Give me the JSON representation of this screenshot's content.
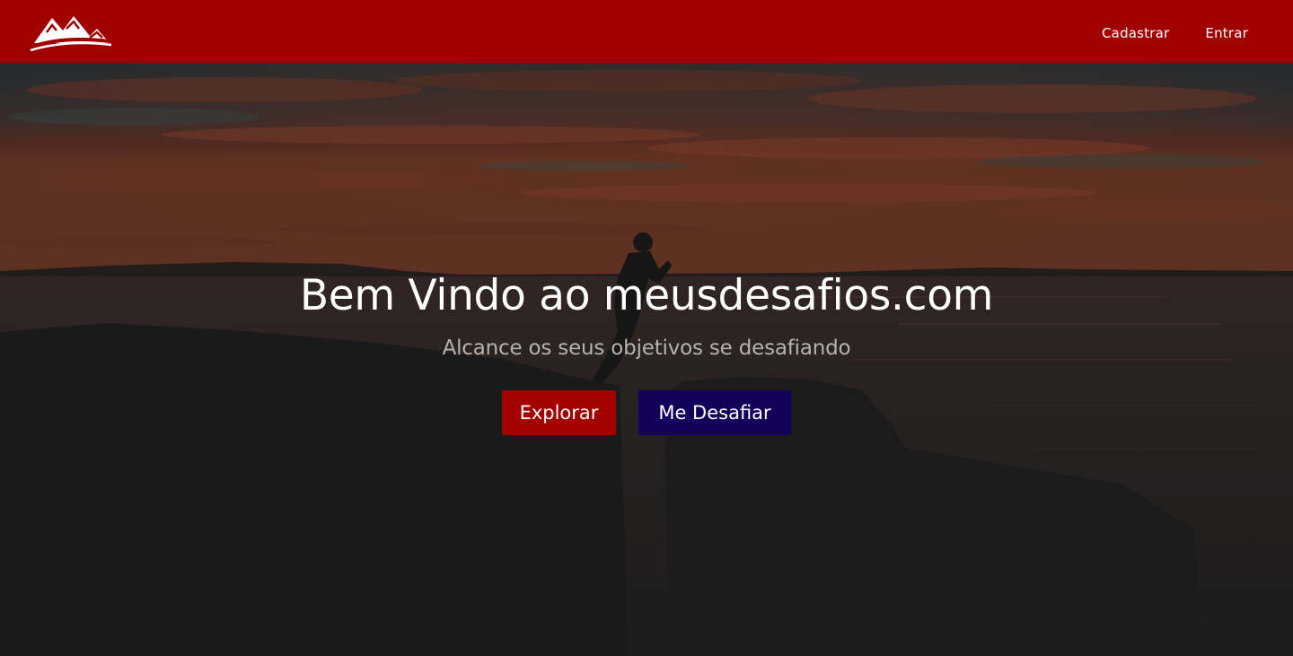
{
  "brand": {
    "logo_icon": "mountains-logo-icon",
    "color": "#a10000"
  },
  "nav": {
    "items": [
      {
        "label": "Cadastrar"
      },
      {
        "label": "Entrar"
      }
    ]
  },
  "hero": {
    "title": "Bem Vindo ao meusdesafios.com",
    "subtitle": "Alcance os seus objetivos se desafiando",
    "buttons": [
      {
        "label": "Explorar",
        "color": "#a30000"
      },
      {
        "label": "Me Desafiar",
        "color": "#130058"
      }
    ],
    "background": "sunset-sea-silhouette-photo"
  }
}
